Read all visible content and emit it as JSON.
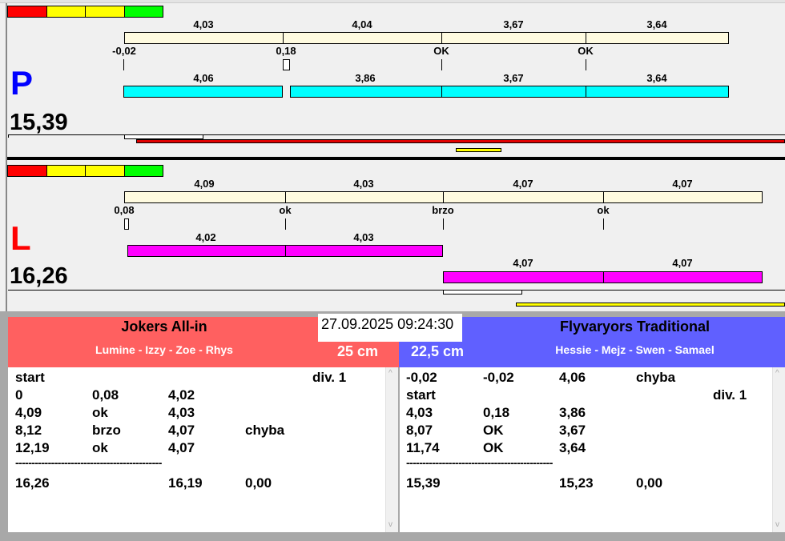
{
  "top": {
    "letter": "P",
    "total": "15,39",
    "upper_labels": [
      "4,03",
      "4,04",
      "3,67",
      "3,64"
    ],
    "marks": [
      "-0,02",
      "0,18",
      "OK",
      "OK"
    ],
    "lower_labels": [
      "4,06",
      "3,86",
      "3,67",
      "3,64"
    ]
  },
  "bottom": {
    "letter": "L",
    "total": "16,26",
    "upper_labels": [
      "4,09",
      "4,03",
      "4,07",
      "4,07"
    ],
    "marks": [
      "0,08",
      "ok",
      "brzo",
      "ok"
    ],
    "lower_labels": [
      "4,02",
      "4,03"
    ],
    "lower2_labels": [
      "4,07",
      "4,07"
    ]
  },
  "colors": {
    "cream": "#fffbe0",
    "cyan": "#00ffff",
    "magenta": "#ff00ff",
    "red_team": "#ff6060",
    "blue_team": "#6060ff"
  },
  "datetime": "27.09.2025 09:24:30",
  "left_team": {
    "name": "Jokers All-in",
    "players": "Lumine - Izzy - Zoe - Rhys",
    "distance": "25 cm",
    "rows": [
      [
        "start",
        "",
        "",
        "",
        "div. 1"
      ],
      [
        "0",
        "0,08",
        "4,02",
        "",
        ""
      ],
      [
        "4,09",
        "ok",
        "4,03",
        "",
        ""
      ],
      [
        "8,12",
        "brzo",
        "4,07",
        "chyba",
        ""
      ],
      [
        "12,19",
        "ok",
        "4,07",
        "",
        ""
      ]
    ],
    "separator": "---------------------------------------------",
    "total_row": [
      "16,26",
      "",
      "16,19",
      "0,00"
    ]
  },
  "right_team": {
    "name": "Flyvaryors Traditional",
    "players": "Hessie - Mejz - Swen - Samael",
    "distance": "22,5 cm",
    "rows": [
      [
        "-0,02",
        "-0,02",
        "4,06",
        "chyba",
        ""
      ],
      [
        "start",
        "",
        "",
        "",
        "div. 1"
      ],
      [
        "4,03",
        "0,18",
        "3,86",
        "",
        ""
      ],
      [
        "8,07",
        "OK",
        "3,67",
        "",
        ""
      ],
      [
        "11,74",
        "OK",
        "3,64",
        "",
        ""
      ]
    ],
    "separator": "---------------------------------------------",
    "total_row": [
      "15,39",
      "",
      "15,23",
      "0,00"
    ]
  }
}
